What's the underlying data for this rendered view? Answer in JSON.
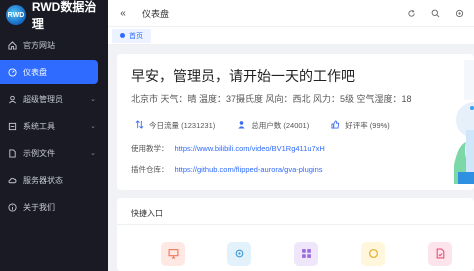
{
  "brand": {
    "name": "RWD数据治理",
    "logo_text": "RWD"
  },
  "sidebar": {
    "items": [
      {
        "label": "官方网站",
        "icon": "home-icon",
        "active": false,
        "has_children": false
      },
      {
        "label": "仪表盘",
        "icon": "dashboard-icon",
        "active": true,
        "has_children": false
      },
      {
        "label": "超级管理员",
        "icon": "user-icon",
        "active": false,
        "has_children": true
      },
      {
        "label": "系统工具",
        "icon": "tool-icon",
        "active": false,
        "has_children": true
      },
      {
        "label": "示例文件",
        "icon": "file-icon",
        "active": false,
        "has_children": true
      },
      {
        "label": "服务器状态",
        "icon": "cloud-icon",
        "active": false,
        "has_children": false
      },
      {
        "label": "关于我们",
        "icon": "info-icon",
        "active": false,
        "has_children": false
      }
    ]
  },
  "header": {
    "collapse": "«",
    "breadcrumb": "仪表盘"
  },
  "tabs": [
    {
      "label": "首页"
    }
  ],
  "welcome": {
    "greeting": "早安，管理员，请开始一天的工作吧",
    "weather": "北京市 天气：晴 温度：37摄氏度 风向：西北 风力：5级 空气湿度：18",
    "stats": [
      {
        "label": "今日流量 (1231231)",
        "icon": "traffic-icon"
      },
      {
        "label": "总用户数 (24001)",
        "icon": "users-icon"
      },
      {
        "label": "好评率 (99%)",
        "icon": "like-icon"
      }
    ],
    "links": [
      {
        "label": "使用教学：",
        "url": "https://www.bilibili.com/video/BV1Rg411u7xH"
      },
      {
        "label": "插件仓库：",
        "url": "https://github.com/flipped-aurora/gva-plugins"
      }
    ]
  },
  "quick_entry": {
    "title": "快捷入口",
    "items": [
      {
        "icon": "monitor-icon",
        "color": "#fde8e3",
        "fg": "#f0745a"
      },
      {
        "icon": "settings-icon",
        "color": "#e3f1fb",
        "fg": "#3a9ad8"
      },
      {
        "icon": "grid-icon",
        "color": "#efe6fb",
        "fg": "#9a6ad8"
      },
      {
        "icon": "circle-icon",
        "color": "#fff6dc",
        "fg": "#e6b23a"
      },
      {
        "icon": "doc-icon",
        "color": "#fde3ec",
        "fg": "#e8527a"
      }
    ]
  }
}
